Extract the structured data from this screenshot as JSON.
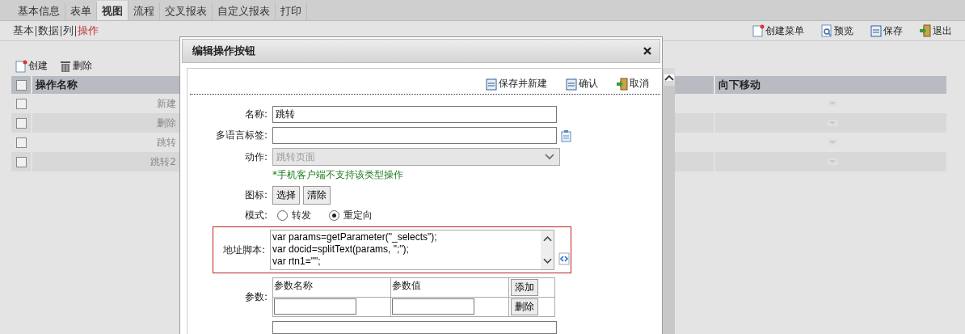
{
  "tabs": [
    {
      "label": "基本信息",
      "selected": false
    },
    {
      "label": "表单",
      "selected": false
    },
    {
      "label": "视图",
      "selected": true
    },
    {
      "label": "流程",
      "selected": false
    },
    {
      "label": "交叉报表",
      "selected": false
    },
    {
      "label": "自定义报表",
      "selected": false
    },
    {
      "label": "打印",
      "selected": false
    }
  ],
  "subnav": [
    {
      "label": "基本",
      "selected": false
    },
    {
      "label": "数据",
      "selected": false
    },
    {
      "label": "列",
      "selected": false
    },
    {
      "label": "操作",
      "selected": true
    }
  ],
  "toolbar": [
    {
      "kind": "new",
      "label": "创建菜单"
    },
    {
      "kind": "preview",
      "label": "预览"
    },
    {
      "kind": "save",
      "label": "保存"
    },
    {
      "kind": "exit",
      "label": "退出"
    }
  ],
  "list_toolbar": [
    {
      "kind": "new",
      "label": "创建"
    },
    {
      "kind": "delete",
      "label": "删除"
    }
  ],
  "table": {
    "all_checked": false,
    "columns": [
      "操作名称",
      "向下移动"
    ],
    "rows": [
      {
        "name": "新建",
        "checked": false
      },
      {
        "name": "删除",
        "checked": false
      },
      {
        "name": "跳转",
        "checked": false
      },
      {
        "name": "跳转2",
        "checked": false
      }
    ]
  },
  "dialog": {
    "title": "编辑操作按钮",
    "actions": [
      {
        "kind": "save",
        "label": "保存并新建"
      },
      {
        "kind": "save",
        "label": "确认"
      },
      {
        "kind": "exit",
        "label": "取消"
      }
    ],
    "name": {
      "label": "名称:",
      "value": "跳转"
    },
    "i18n": {
      "label": "多语言标签:"
    },
    "action": {
      "label": "动作:",
      "value": "跳转页面",
      "disabled": true,
      "note": "*手机客户端不支持该类型操作"
    },
    "icon": {
      "label": "图标:",
      "buttons": [
        "选择",
        "清除"
      ]
    },
    "mode": {
      "label": "模式:",
      "options": [
        {
          "label": "转发",
          "selected": false
        },
        {
          "label": "重定向",
          "selected": true
        }
      ]
    },
    "script": {
      "label": "地址脚本:",
      "value": "var params=getParameter(\"_selects\");\nvar docid=splitText(params, \";\");\nvar rtn1=\"\";"
    },
    "params": {
      "label": "参数:",
      "columns": [
        "参数名称",
        "参数值"
      ],
      "add": "添加",
      "delete": "删除"
    }
  }
}
